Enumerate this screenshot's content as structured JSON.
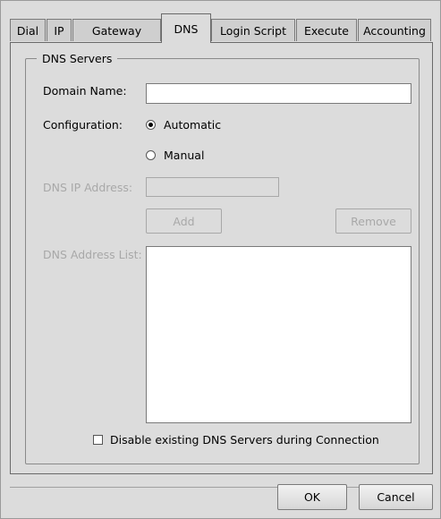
{
  "tabs": [
    {
      "label": "Dial"
    },
    {
      "label": "IP"
    },
    {
      "label": "Gateway"
    },
    {
      "label": "DNS",
      "active": true
    },
    {
      "label": "Login Script"
    },
    {
      "label": "Execute"
    },
    {
      "label": "Accounting"
    }
  ],
  "dns_group": {
    "title": "DNS Servers",
    "domain_name_label": "Domain Name:",
    "domain_name_value": "",
    "configuration_label": "Configuration:",
    "automatic_label": "Automatic",
    "manual_label": "Manual",
    "selected": "automatic",
    "dns_ip_label": "DNS IP Address:",
    "dns_ip_value": "",
    "add_label": "Add",
    "remove_label": "Remove",
    "dns_list_label": "DNS Address List:",
    "dns_list_items": [],
    "disable_existing_label": "Disable existing DNS Servers during Connection",
    "disable_existing_checked": false
  },
  "footer": {
    "ok_label": "OK",
    "cancel_label": "Cancel"
  }
}
